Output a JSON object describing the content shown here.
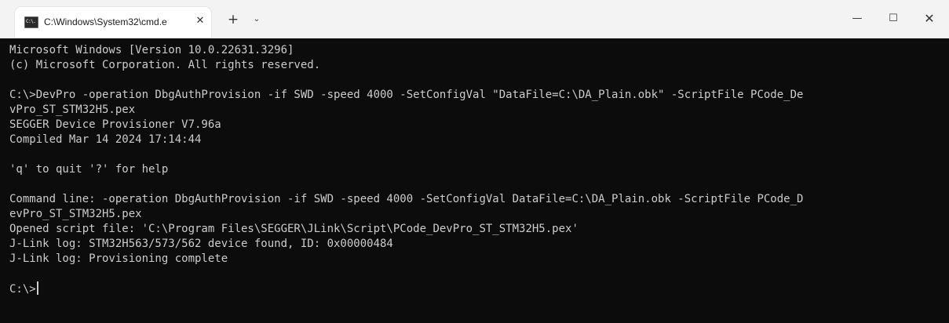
{
  "window": {
    "tab_title": "C:\\Windows\\System32\\cmd.e",
    "tab_icon_text": "C:\\.",
    "close_tab_glyph": "✕",
    "new_tab_glyph": "+",
    "dropdown_glyph": "⌄",
    "minimize_glyph": "—",
    "maximize_glyph": "☐",
    "close_glyph": "✕"
  },
  "terminal": {
    "lines": [
      "Microsoft Windows [Version 10.0.22631.3296]",
      "(c) Microsoft Corporation. All rights reserved.",
      "",
      "C:\\>DevPro -operation DbgAuthProvision -if SWD -speed 4000 -SetConfigVal \"DataFile=C:\\DA_Plain.obk\" -ScriptFile PCode_De",
      "vPro_ST_STM32H5.pex",
      "SEGGER Device Provisioner V7.96a",
      "Compiled Mar 14 2024 17:14:44",
      "",
      "'q' to quit '?' for help",
      "",
      "Command line: -operation DbgAuthProvision -if SWD -speed 4000 -SetConfigVal DataFile=C:\\DA_Plain.obk -ScriptFile PCode_D",
      "evPro_ST_STM32H5.pex",
      "Opened script file: 'C:\\Program Files\\SEGGER\\JLink\\Script\\PCode_DevPro_ST_STM32H5.pex'",
      "J-Link log: STM32H563/573/562 device found, ID: 0x00000484",
      "J-Link log: Provisioning complete",
      ""
    ],
    "prompt": "C:\\>"
  },
  "colors": {
    "terminal_bg": "#0c0c0c",
    "terminal_fg": "#cccccc",
    "titlebar_bg": "#f3f3f3",
    "tab_bg": "#ffffff"
  }
}
